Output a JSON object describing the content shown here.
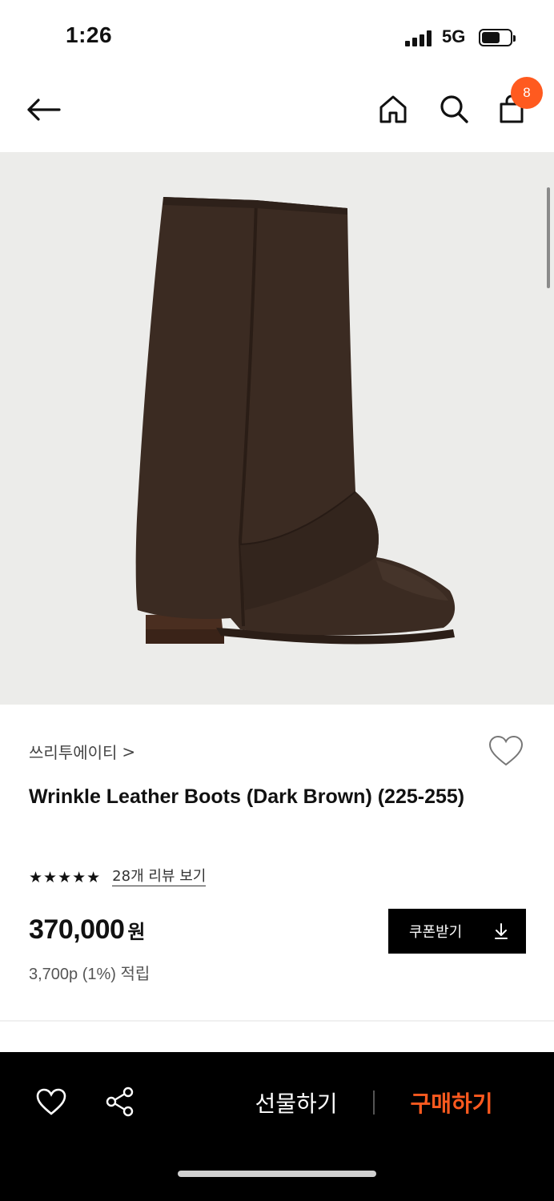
{
  "status": {
    "time": "1:26",
    "network": "5G"
  },
  "header": {
    "cart_count": "8",
    "icons": [
      "back-arrow-icon",
      "home-icon",
      "search-icon",
      "shopping-bag-icon"
    ]
  },
  "product": {
    "brand": "쓰리투에이티",
    "brand_chevron": ">",
    "title": "Wrinkle Leather Boots (Dark Brown) (225-255)",
    "stars": "★★★★★",
    "rating_stars": 5,
    "review_link": "28개 리뷰 보기",
    "price": "370,000",
    "price_unit": "원",
    "points": "3,700p (1%) 적립",
    "coupon_label": "쿠폰받기",
    "coupon_icon": "↓"
  },
  "bottom_bar": {
    "gift_label": "선물하기",
    "buy_label": "구매하기",
    "accent_color": "#ff5a1f"
  },
  "colors": {
    "accent": "#ff5a1f",
    "image_background": "#ececea",
    "boot": "#3a2a21"
  }
}
